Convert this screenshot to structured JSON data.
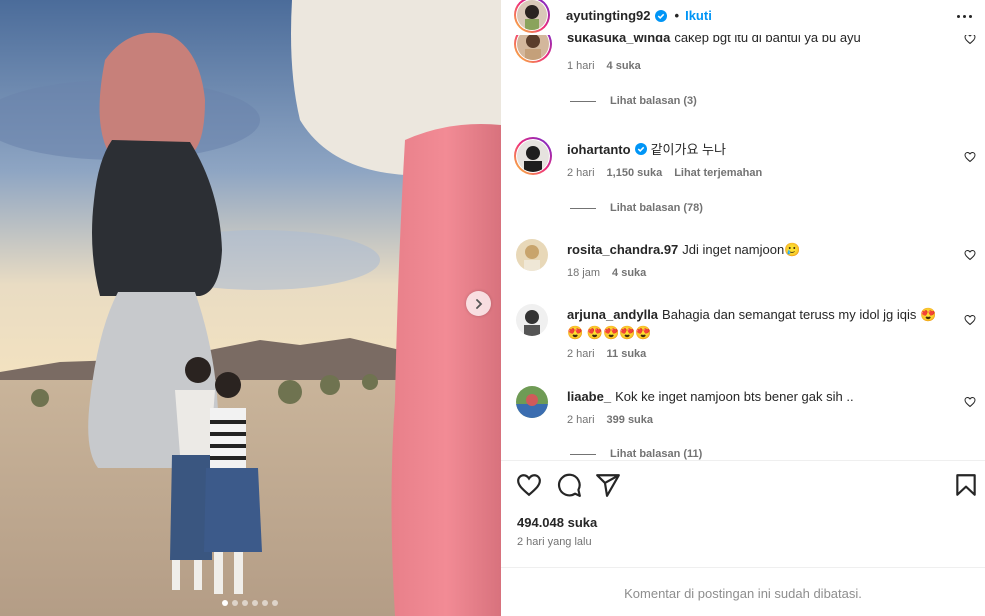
{
  "post": {
    "username": "ayutingting92",
    "follow_label": "Ikuti",
    "likes": "494.048 suka",
    "date": "2 hari yang lalu",
    "comments_limited": "Komentar di postingan ini sudah dibatasi."
  },
  "carousel": {
    "slide_count": 6,
    "active_index": 0
  },
  "comments": [
    {
      "user": "sukasuka_winda",
      "text": "cakep bgt itu di bantul ya bu ayu",
      "time": "1 hari",
      "likes": "4 suka",
      "translate": "",
      "replies": "Lihat balasan (3)"
    },
    {
      "user": "iohartanto",
      "text": "같이가요 누나",
      "time": "2 hari",
      "likes": "1,150 suka",
      "translate": "Lihat terjemahan",
      "replies": "Lihat balasan (78)"
    },
    {
      "user": "rosita_chandra.97",
      "text": "Jdi inget namjoon🥲",
      "time": "18 jam",
      "likes": "4 suka",
      "translate": "",
      "replies": ""
    },
    {
      "user": "arjuna_andylla",
      "text": "Bahagia dan semangat teruss my idol jg iqis 😍😍 😍😍😍😍",
      "time": "2 hari",
      "likes": "11 suka",
      "translate": "",
      "replies": ""
    },
    {
      "user": "liaabe_",
      "text": "Kok ke inget namjoon bts bener gak sih ..",
      "time": "2 hari",
      "likes": "399 suka",
      "translate": "",
      "replies": "Lihat balasan (11)"
    }
  ],
  "icons": {
    "verified": "verified-badge-icon",
    "like": "heart-icon",
    "comment": "comment-icon",
    "share": "share-icon",
    "save": "bookmark-icon",
    "more": "more-options-icon",
    "next": "chevron-right-icon"
  },
  "colors": {
    "accent": "#0095f6",
    "secondary_text": "#737373",
    "primary_text": "#262626"
  }
}
